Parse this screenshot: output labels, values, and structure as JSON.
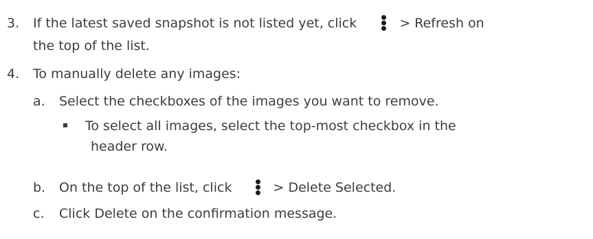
{
  "steps": [
    {
      "marker": "3.",
      "line1_before": "If the latest saved snapshot is not listed yet, click",
      "line1_after": "> Refresh on",
      "line2": "the top of the list."
    },
    {
      "marker": "4.",
      "text": "To manually delete any images:",
      "substeps": [
        {
          "marker": "a.",
          "text": "Select the checkboxes of the images you want to remove.",
          "bullet_line1": "To select all images, select the top-most checkbox in the",
          "bullet_line2": "header row."
        },
        {
          "marker": "b.",
          "text_before": "On the top of the list, click",
          "text_after": "> Delete Selected."
        },
        {
          "marker": "c.",
          "text": "Click Delete on the confirmation message."
        }
      ]
    }
  ],
  "icons": {
    "menu": "more-vertical-icon"
  }
}
